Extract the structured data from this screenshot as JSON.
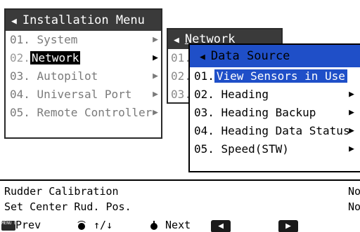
{
  "menu1": {
    "title": "Installation Menu",
    "items": [
      {
        "num": "01.",
        "label": "System"
      },
      {
        "num": "02.",
        "label": "Network"
      },
      {
        "num": "03.",
        "label": "Autopilot"
      },
      {
        "num": "04.",
        "label": "Universal Port"
      },
      {
        "num": "05.",
        "label": "Remote Controller"
      }
    ]
  },
  "menu2": {
    "title": "Network",
    "items": [
      {
        "num": "01."
      },
      {
        "num": "02."
      },
      {
        "num": "03."
      }
    ]
  },
  "menu3": {
    "title": "Data Source",
    "items": [
      {
        "num": "01.",
        "label": "View Sensors in Use"
      },
      {
        "num": "02.",
        "label": "Heading"
      },
      {
        "num": "03.",
        "label": "Heading Backup"
      },
      {
        "num": "04.",
        "label": "Heading Data Status"
      },
      {
        "num": "05.",
        "label": "Speed(STW)"
      }
    ]
  },
  "status": {
    "rudder_calibration": {
      "label": "Rudder Calibration",
      "value": "No"
    },
    "set_center": {
      "label": "Set Center Rud. Pos.",
      "value": "No"
    }
  },
  "footer": {
    "menu_esc_icon_text": "MENU ESC",
    "prev": "Prev",
    "scroll": "↑/↓",
    "next": "Next"
  },
  "icons": {
    "arrow": "right-triangle-icon",
    "back": "left-triangle-icon"
  },
  "colors": {
    "selection_blue": "#1f4fc8",
    "title_bar_dark": "#3a3a3a"
  }
}
